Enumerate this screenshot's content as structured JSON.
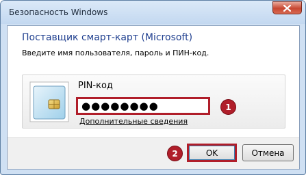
{
  "window": {
    "title": "Безопасность Windows"
  },
  "dialog": {
    "heading": "Поставщик смарт-карт (Microsoft)",
    "instruction": "Введите имя пользователя, пароль и ПИН-код."
  },
  "credential": {
    "icon": "smart-card-icon",
    "pin_label": "PIN-код",
    "pin_value": "●●●●●●●●",
    "more_link": "Дополнительные сведения"
  },
  "annotations": {
    "step1": "1",
    "step2": "2",
    "highlight_color": "#b01e2a"
  },
  "buttons": {
    "ok_label": "OK",
    "cancel_label": "Отмена"
  },
  "titlebar_icons": [
    "close-icon"
  ]
}
